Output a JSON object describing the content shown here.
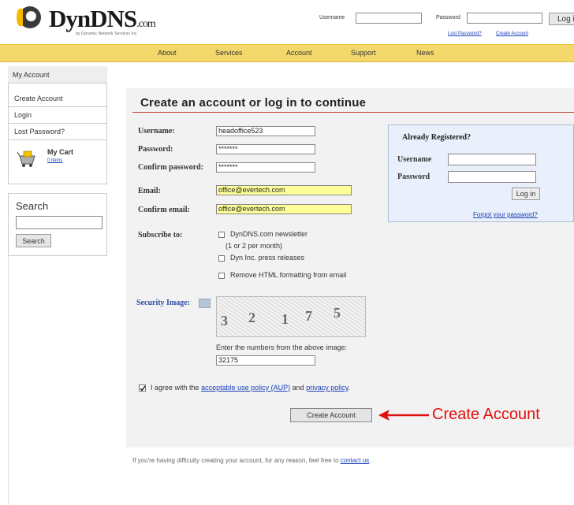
{
  "header": {
    "logo_text": "DynDNS",
    "logo_suffix": ".com",
    "logo_subtitle": "by Dynamic Network Services Inc.",
    "username_label": "Username",
    "password_label": "Password",
    "login_label": "Log i",
    "lost_password_link": "Lost Password?",
    "create_account_link": "Create Account"
  },
  "nav": {
    "items": [
      {
        "label": "About"
      },
      {
        "label": "Services"
      },
      {
        "label": "Account"
      },
      {
        "label": "Support"
      },
      {
        "label": "News"
      }
    ]
  },
  "sidebar": {
    "header": "My Account",
    "items": [
      {
        "label": "Create Account"
      },
      {
        "label": "Login"
      },
      {
        "label": "Lost Password?"
      }
    ],
    "cart_title": "My Cart",
    "cart_items": "0 items",
    "search_title": "Search",
    "search_button": "Search"
  },
  "form": {
    "title": "Create an account or log in to continue",
    "username_label": "Username:",
    "username_value": "headoffice523",
    "password_label": "Password:",
    "password_value": "*******",
    "confirm_password_label": "Confirm password:",
    "confirm_password_value": "*******",
    "email_label": "Email:",
    "email_value": "office@evertech.com",
    "confirm_email_label": "Confirm email:",
    "confirm_email_value": "office@evertech.com",
    "subscribe_label": "Subscribe to:",
    "subscribe_options": [
      {
        "label": "DynDNS.com newsletter",
        "note": "(1 or 2 per month)",
        "checked": false
      },
      {
        "label": "Dyn Inc. press releases",
        "checked": false
      },
      {
        "label": "Remove HTML formatting from email",
        "checked": false
      }
    ],
    "security_label": "Security Image:",
    "captcha_digits": [
      "3",
      "2",
      "1",
      "7",
      "5"
    ],
    "captcha_prompt": "Enter the numbers from the above image:",
    "captcha_value": "32175",
    "agree_prefix": "I agree with the",
    "aup_link": "acceptable use policy (AUP)",
    "agree_and": "and",
    "privacy_link": "privacy policy",
    "agree_suffix": ".",
    "agree_checked": true,
    "create_button": "Create Account"
  },
  "registered": {
    "title": "Already Registered?",
    "username_label": "Username",
    "password_label": "Password",
    "login_button": "Log in",
    "forgot_link": "Forgot your password?"
  },
  "annotation": {
    "text": "Create Account",
    "color": "#e01010"
  },
  "footer": {
    "text": "If you're having difficulty creating your account, for any reason, feel free to",
    "link": "contact us",
    "end": "."
  }
}
